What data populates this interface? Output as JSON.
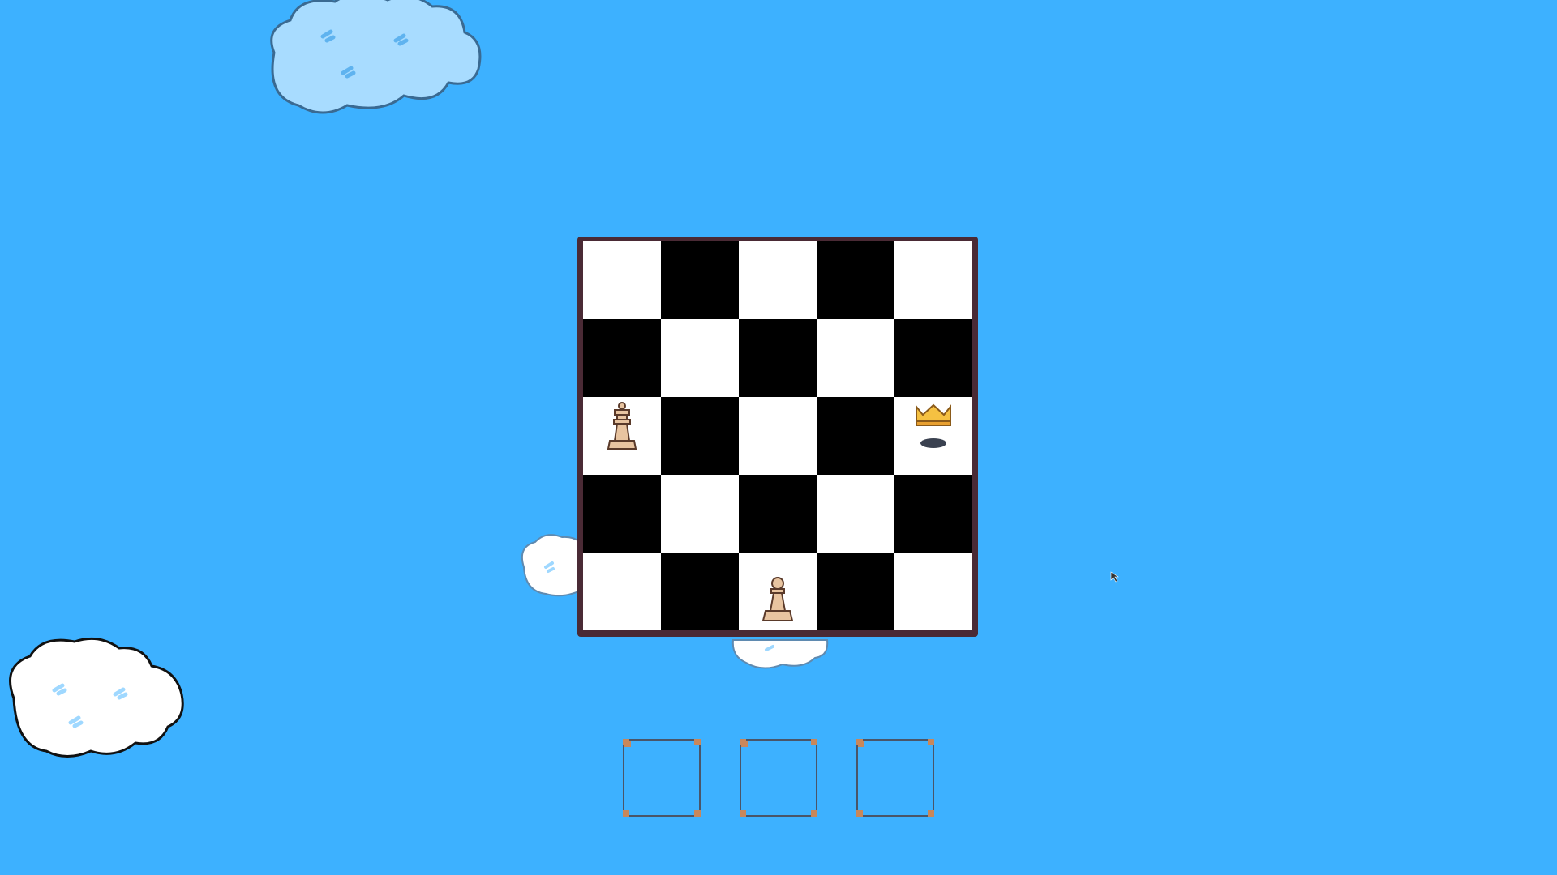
{
  "board": {
    "size": 5,
    "pieces": [
      {
        "row": 3,
        "col": 1,
        "type": "queen",
        "color": "tan"
      },
      {
        "row": 5,
        "col": 3,
        "type": "pawn",
        "color": "tan"
      }
    ],
    "crown_marker": {
      "row": 3,
      "col": 5,
      "icon": "crown-icon"
    }
  },
  "inventory": {
    "slots": [
      {
        "label": "",
        "item": null
      },
      {
        "label": "",
        "item": null
      },
      {
        "label": "",
        "item": null
      }
    ]
  },
  "colors": {
    "sky": "#3db1ff",
    "board_frame": "#4a2a35",
    "light_square": "#ffffff",
    "dark_square": "#000000",
    "piece_tan": "#e8c4a0",
    "crown_gold": "#f5c142"
  }
}
